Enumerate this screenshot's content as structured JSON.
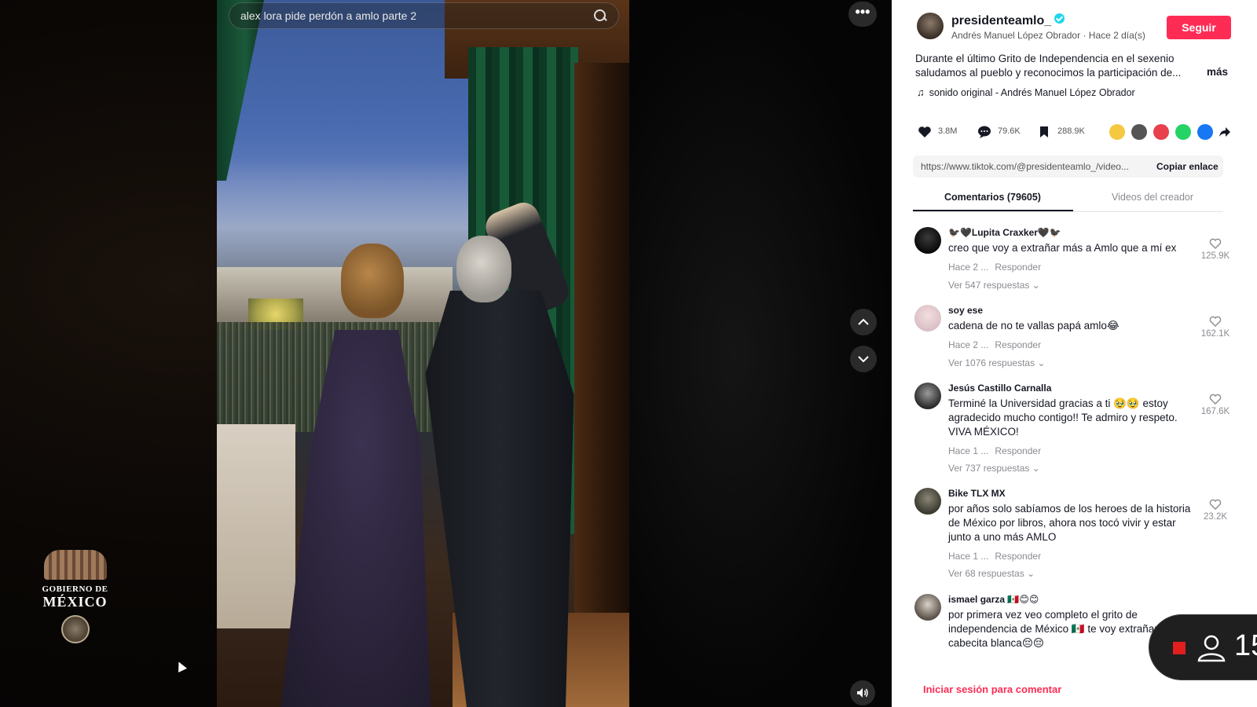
{
  "video": {
    "search_query": "alex lora pide perdón a amlo parte 2"
  },
  "brand": {
    "logo_line1": "GOBIERNO DE",
    "logo_line2": "MÉXICO"
  },
  "author": {
    "username": "presidenteamlo_",
    "display_name": "Andrés Manuel López Obrador",
    "posted": "Hace 2 día(s)",
    "follow_label": "Seguir"
  },
  "post": {
    "description": "Durante el último Grito de Independencia en el sexenio saludamos al pueblo y reconocimos la participación de...",
    "more_label": "más",
    "sound": "sonido original - Andrés Manuel López Obrador"
  },
  "stats": {
    "likes": "3.8M",
    "comments": "79.6K",
    "saves": "288.9K"
  },
  "share": {
    "link": "https://www.tiktok.com/@presidenteamlo_/video...",
    "copy_label": "Copiar enlace"
  },
  "tabs": {
    "comments": "Comentarios (79605)",
    "creator_videos": "Videos del creador"
  },
  "comments": [
    {
      "name": "🐦‍⬛🖤Lupita Craxker🖤🐦‍⬛",
      "text": "creo que voy a extrañar más a Amlo que a mí ex",
      "time": "Hace 2 ...",
      "reply": "Responder",
      "replies": "Ver 547 respuestas",
      "likes": "125.9K"
    },
    {
      "name": "soy ese",
      "text": "cadena de no te vallas papá amlo😂",
      "time": "Hace 2 ...",
      "reply": "Responder",
      "replies": "Ver 1076 respuestas",
      "likes": "162.1K"
    },
    {
      "name": "Jesús Castillo Carnalla",
      "text": "Terminé la Universidad gracias a ti 🥹🥹 estoy agradecido mucho contigo!! Te admiro y respeto. VIVA MÉXICO!",
      "time": "Hace 1 ...",
      "reply": "Responder",
      "replies": "Ver 737 respuestas",
      "likes": "167.6K"
    },
    {
      "name": "Bike TLX MX",
      "text": "por años solo sabíamos de los heroes de la historia de México por libros, ahora nos tocó vivir y estar junto a uno más AMLO",
      "time": "Hace 1 ...",
      "reply": "Responder",
      "replies": "Ver 68 respuestas",
      "likes": "23.2K"
    },
    {
      "name": "ismael garza 🇲🇽😊😊",
      "text": "por primera vez veo completo el grito de independencia de México 🇲🇽 te voy extrañar mi cabecita blanca😔😔",
      "time": "",
      "reply": "",
      "replies": "",
      "likes": ""
    }
  ],
  "footer": {
    "login_prompt": "Iniciar sesión para comentar"
  },
  "live": {
    "viewers": "15"
  },
  "colors": {
    "accent": "#fe2c55",
    "verified": "#20d5ec"
  }
}
